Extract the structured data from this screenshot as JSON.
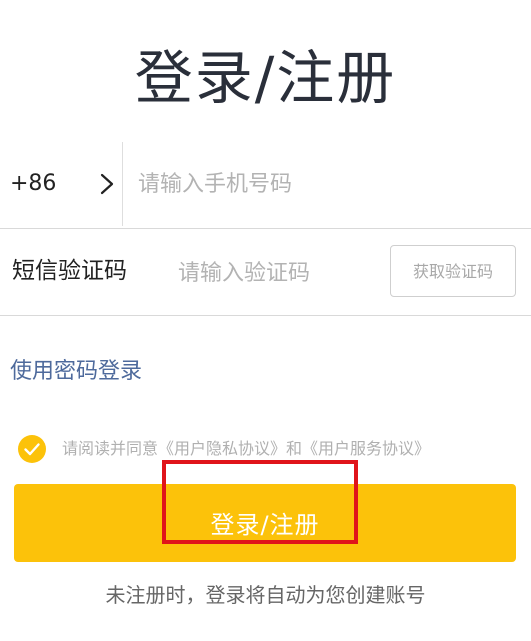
{
  "page": {
    "title": "登录/注册",
    "footnote": "未注册时，登录将自动为您创建账号"
  },
  "phone": {
    "country_code": "+86",
    "placeholder": "请输入手机号码"
  },
  "sms": {
    "label": "短信验证码",
    "placeholder": "请输入验证码",
    "get_code_label": "获取验证码"
  },
  "password_login_link": "使用密码登录",
  "agreement": {
    "checked": true,
    "text": "请阅读并同意《用户隐私协议》和《用户服务协议》"
  },
  "login_button": {
    "label": "登录/注册"
  },
  "icons": {
    "country_selector": "chevron-right-icon",
    "agreement_checkbox": "check-circle-icon"
  },
  "colors": {
    "accent": "#fcc20a",
    "link": "#4e6a9c",
    "highlight": "#e0141a"
  }
}
